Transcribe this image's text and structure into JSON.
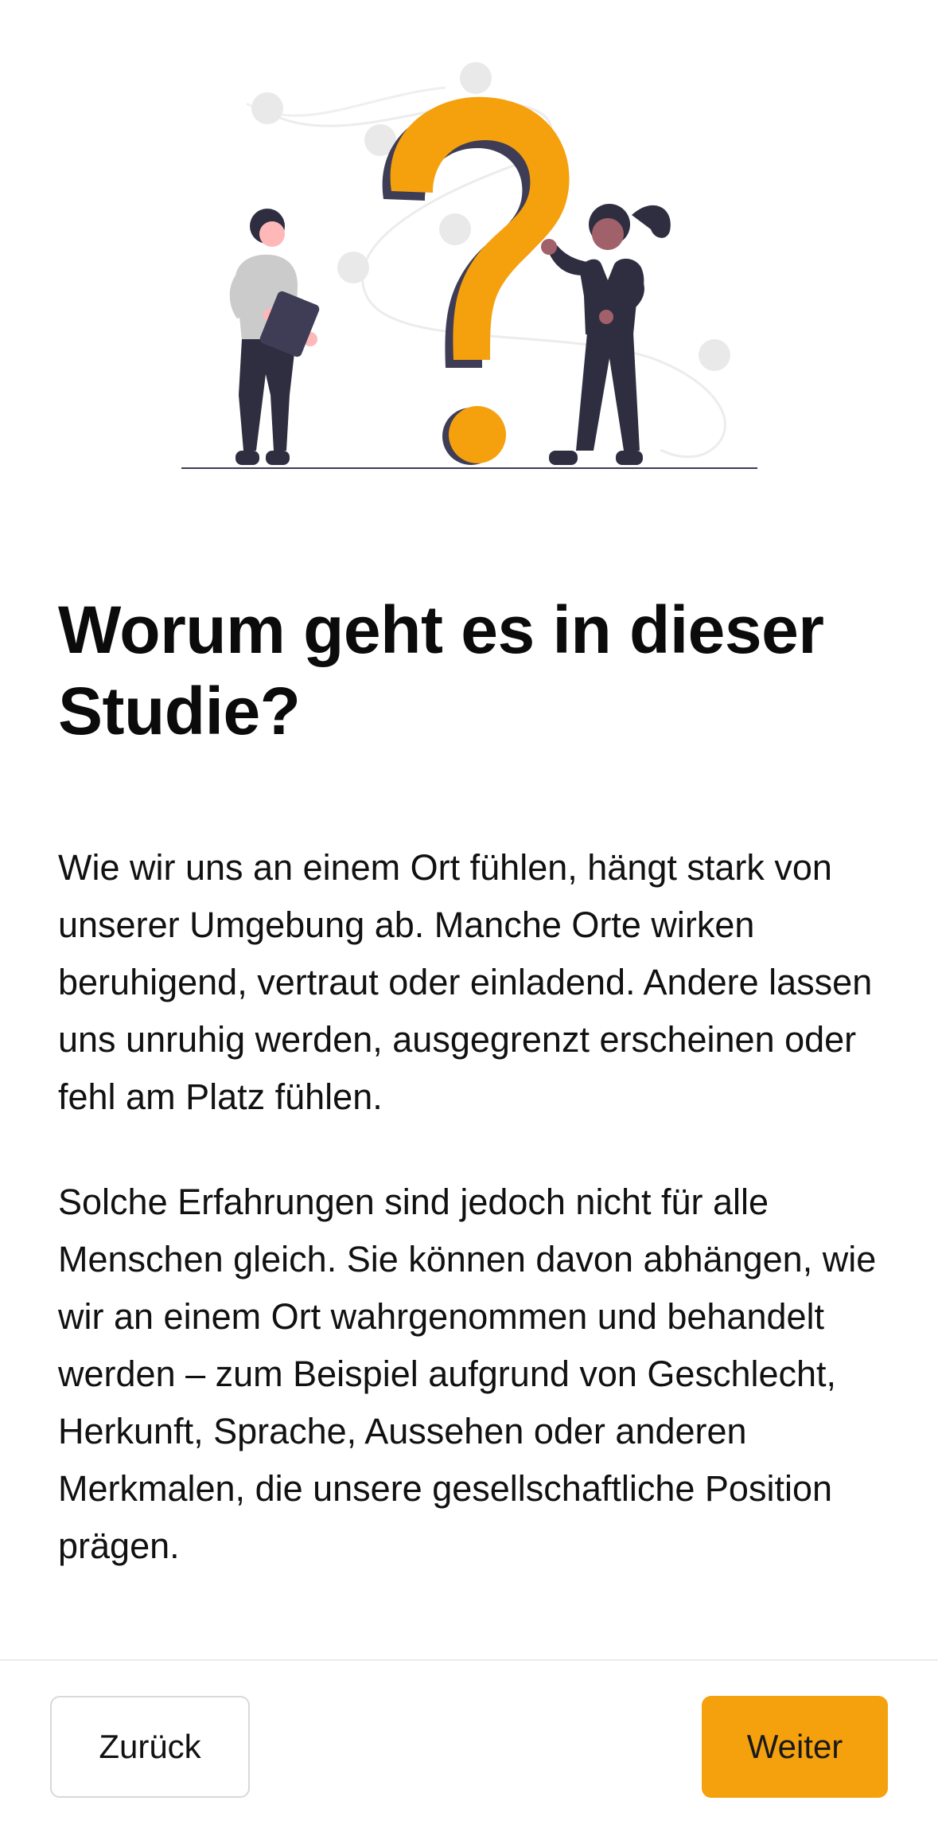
{
  "page": {
    "title": "Worum geht es in dieser Studie?",
    "paragraphs": [
      "Wie wir uns an einem Ort fühlen, hängt stark von unserer Umgebung ab. Manche Orte wirken beruhigend, vertraut oder einladend. Andere lassen uns unruhig werden, ausgegrenzt erscheinen oder fehl am Platz fühlen.",
      "Solche Erfahrungen sind jedoch nicht für alle Menschen gleich. Sie können davon abhängen, wie wir an einem Ort wahrgenommen und behandelt werden – zum Beispiel aufgrund von Geschlecht, Herkunft, Sprache, Aussehen oder anderen Merkmalen, die unsere gesellschaftliche Position prägen."
    ]
  },
  "footer": {
    "back_label": "Zurück",
    "next_label": "Weiter"
  },
  "illustration": {
    "icon": "question-mark-people-illustration",
    "accent_color": "#f5a10e",
    "dark_color": "#2f2e41"
  }
}
